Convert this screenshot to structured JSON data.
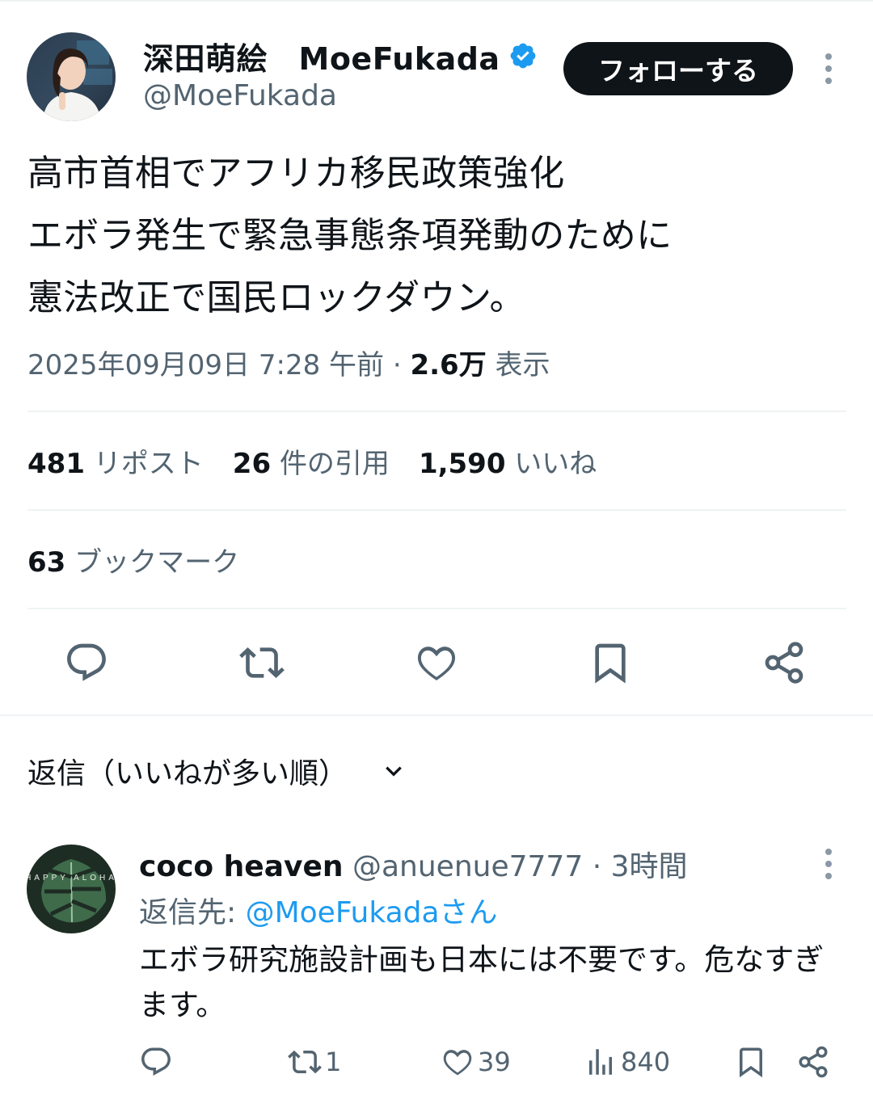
{
  "author": {
    "display_name": "深田萌絵　MoeFukada",
    "handle": "@MoeFukada",
    "follow_label": "フォローする"
  },
  "tweet": {
    "text": "高市首相でアフリカ移民政策強化\nエボラ発生で緊急事態条項発動のために\n憲法改正で国民ロックダウン。",
    "timestamp": "2025年09月09日 7:28 午前",
    "separator": "·",
    "views_count": "2.6万",
    "views_label": "表示"
  },
  "stats": {
    "reposts_count": "481",
    "reposts_label": "リポスト",
    "quotes_count": "26",
    "quotes_label": "件の引用",
    "likes_count": "1,590",
    "likes_label": "いいね",
    "bookmarks_count": "63",
    "bookmarks_label": "ブックマーク"
  },
  "replies": {
    "sort_label": "返信（いいねが多い順）",
    "items": [
      {
        "name": "coco heaven",
        "handle": "@anuenue7777",
        "dot": "·",
        "time": "3時間",
        "reply_to_label": "返信先: ",
        "reply_to_mention": "@MoeFukadaさん",
        "text": "エボラ研究施設計画も日本には不要です。危なすぎます。",
        "retweets": "1",
        "likes": "39",
        "views": "840",
        "avatar_text": "HAPPY ALOHA"
      }
    ]
  },
  "icons": [
    "verified-badge-icon",
    "more-icon",
    "reply-icon",
    "retweet-icon",
    "like-icon",
    "bookmark-icon",
    "share-icon",
    "chevron-down-icon",
    "views-icon"
  ],
  "colors": {
    "accent": "#1d9bf0",
    "text": "#0f1419",
    "secondary": "#536471",
    "divider": "#eff3f4"
  }
}
